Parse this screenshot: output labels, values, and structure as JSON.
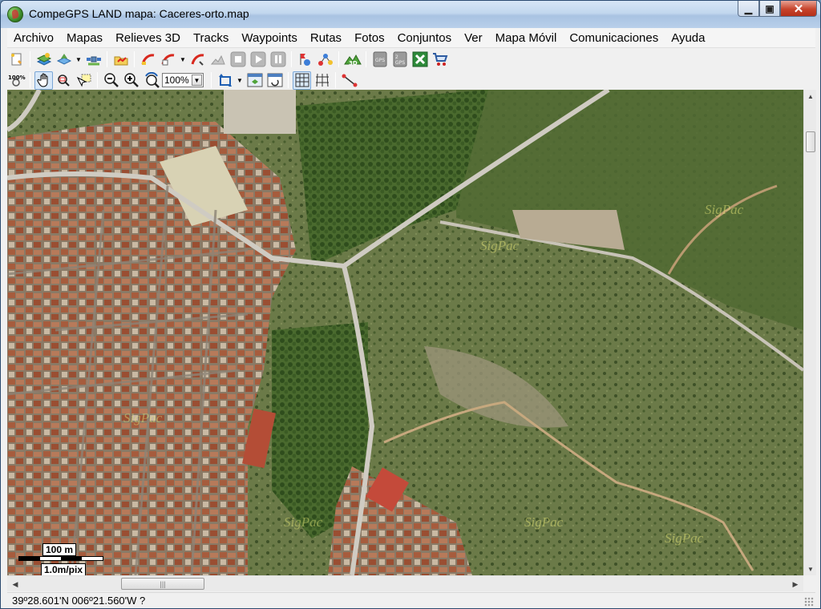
{
  "window": {
    "title": "CompeGPS LAND mapa: Caceres-orto.map",
    "min_glyph": "▁",
    "max_glyph": "▣",
    "close_glyph": "✕"
  },
  "menu": [
    "Archivo",
    "Mapas",
    "Relieves 3D",
    "Tracks",
    "Waypoints",
    "Rutas",
    "Fotos",
    "Conjuntos",
    "Ver",
    "Mapa Móvil",
    "Comunicaciones",
    "Ayuda"
  ],
  "toolbar": {
    "zoom_value": "100%",
    "zoom_100_label": "100%",
    "dropdown_glyph": "▼"
  },
  "map": {
    "scale_distance": "100 m",
    "scale_resolution": "1.0m/pix",
    "watermark_text": "SigPac"
  },
  "scroll": {
    "up": "▲",
    "down": "▼",
    "left": "◀",
    "right": "▶",
    "grip": "|||"
  },
  "status": {
    "coordinates": "39º28.601'N 006º21.560'W  ?"
  },
  "colors": {
    "titlebar_blue": "#c2d7ee",
    "close_red": "#c7442c",
    "vegetation_green": "#5b7a3a",
    "road_gray": "#b9b6ae",
    "roof_terracotta": "#a85a3c"
  }
}
